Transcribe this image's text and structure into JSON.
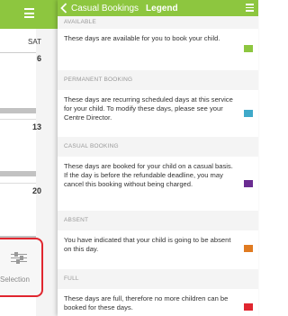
{
  "background_calendar": {
    "day_label": "SAT",
    "dates": [
      "6",
      "13",
      "20"
    ],
    "selection_label": "Selection"
  },
  "header": {
    "back_label": "Casual Bookings",
    "title": "Legend"
  },
  "legend": [
    {
      "title": "AVAILABLE",
      "description": "These days are available for you to book your child.",
      "color": "#8dc63f"
    },
    {
      "title": "PERMANENT BOOKING",
      "description": "These days are recurring scheduled days at this service for your child. To modify these days, please see your Centre Director.",
      "color": "#3fa9c9"
    },
    {
      "title": "CASUAL BOOKING",
      "description": "These days are booked for your child on a casual basis. If the day is before the refundable deadline, you may cancel this booking without being charged.",
      "color": "#6a2c91"
    },
    {
      "title": "ABSENT",
      "description": "You have indicated that your child is going to be absent on this day.",
      "color": "#e07b21"
    },
    {
      "title": "FULL",
      "description": "These days are full, therefore no more children can be booked for these days.",
      "color": "#e0262f"
    }
  ]
}
